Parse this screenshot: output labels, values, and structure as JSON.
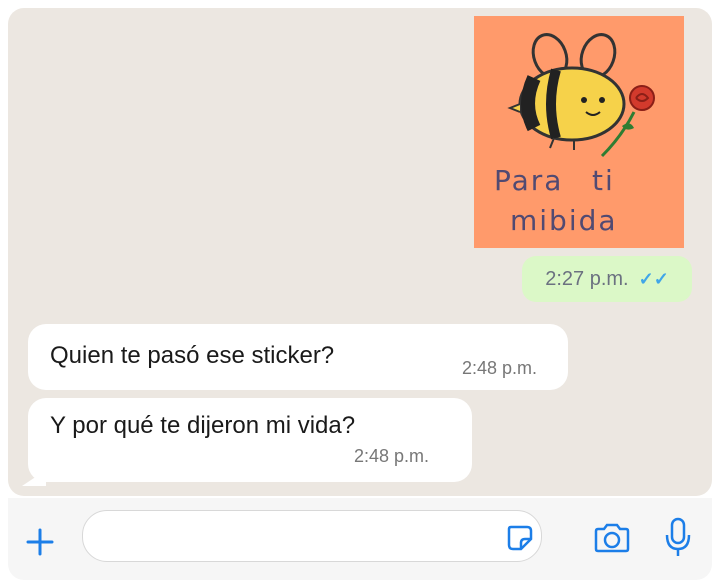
{
  "sticker": {
    "text_line1_a": "Para",
    "text_line1_b": "ti",
    "text_line2": "mibida",
    "background_color": "#ff9a6b"
  },
  "sent_message": {
    "time": "2:27 p.m.",
    "status": "read",
    "check_icon": "double-check-icon",
    "check_color": "#40a6e8"
  },
  "received_messages": [
    {
      "text": "Quien te pasó ese sticker?",
      "time": "2:48 p.m."
    },
    {
      "text": "Y por qué te dijeron mi vida?",
      "time": "2:48 p.m."
    }
  ],
  "input_bar": {
    "icons": [
      "plus-icon",
      "sticker-icon",
      "camera-icon",
      "mic-icon"
    ],
    "accent_color": "#1c7ee8"
  }
}
